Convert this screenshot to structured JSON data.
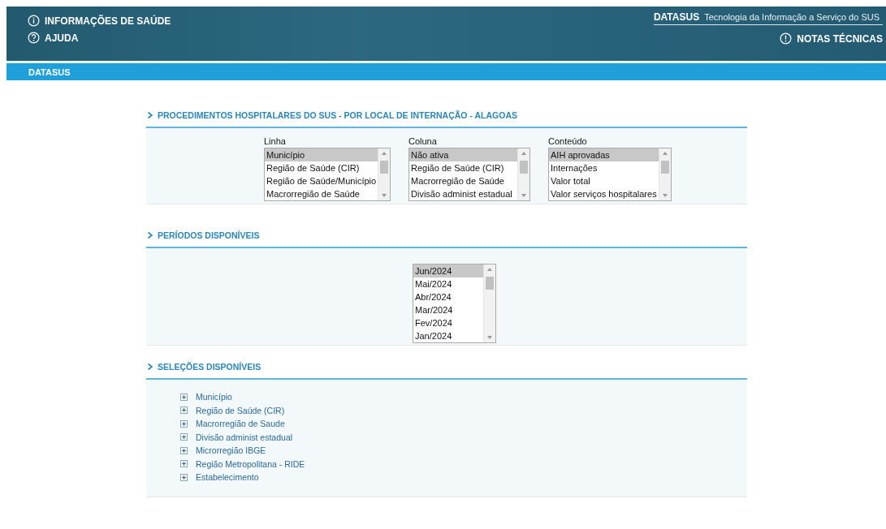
{
  "header": {
    "links": [
      {
        "label": "INFORMAÇÕES DE SAÚDE"
      },
      {
        "label": "AJUDA"
      }
    ],
    "brand": {
      "name": "DATASUS",
      "tagline": "Tecnologia da Informação a Serviço do SUS"
    },
    "notes_link": {
      "label": "NOTAS TÉCNICAS"
    }
  },
  "breadcrumb": "DATASUS",
  "sections": [
    {
      "kind": "selectors",
      "title": "PROCEDIMENTOS HOSPITALARES DO SUS - POR LOCAL DE INTERNAÇÃO - ALAGOAS",
      "lists": [
        {
          "label": "Linha",
          "options": [
            {
              "text": "Município",
              "selected": true
            },
            {
              "text": "Região de Saúde (CIR)",
              "selected": false
            },
            {
              "text": "Região de Saúde/Município",
              "selected": false
            },
            {
              "text": "Macrorregião de Saúde",
              "selected": false
            }
          ]
        },
        {
          "label": "Coluna",
          "options": [
            {
              "text": "Não ativa",
              "selected": true
            },
            {
              "text": "Região de Saúde (CIR)",
              "selected": false
            },
            {
              "text": "Macrorregião de Saúde",
              "selected": false
            },
            {
              "text": "Divisão administ estadual",
              "selected": false
            }
          ]
        },
        {
          "label": "Conteúdo",
          "options": [
            {
              "text": "AIH aprovadas",
              "selected": true
            },
            {
              "text": "Internações",
              "selected": false
            },
            {
              "text": "Valor total",
              "selected": false
            },
            {
              "text": "Valor serviços hospitalares",
              "selected": false
            }
          ]
        }
      ]
    },
    {
      "kind": "periods",
      "title": "PERÍODOS DISPONÍVEIS",
      "lists": [
        {
          "options": [
            {
              "text": "Jun/2024",
              "selected": true
            },
            {
              "text": "Mai/2024",
              "selected": false
            },
            {
              "text": "Abr/2024",
              "selected": false
            },
            {
              "text": "Mar/2024",
              "selected": false
            },
            {
              "text": "Fev/2024",
              "selected": false
            },
            {
              "text": "Jan/2024",
              "selected": false
            }
          ]
        }
      ]
    },
    {
      "kind": "tree",
      "title": "SELEÇÕES DISPONÍVEIS",
      "items": [
        {
          "label": "Município",
          "expanded": false
        },
        {
          "label": "Região de Saúde (CIR)",
          "expanded": false
        },
        {
          "label": "Macrorregião de Saude",
          "expanded": false
        },
        {
          "label": "Divisão administ estadual",
          "expanded": false
        },
        {
          "label": "Microrregião IBGE",
          "expanded": false
        },
        {
          "label": "Região Metropolitana - RIDE",
          "expanded": false
        },
        {
          "label": "Estabelecimento",
          "expanded": false
        }
      ]
    }
  ]
}
